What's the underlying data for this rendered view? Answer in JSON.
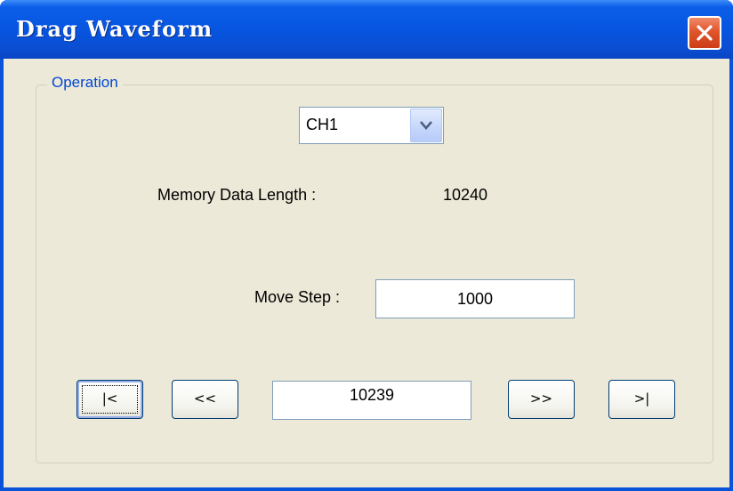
{
  "window": {
    "title": "Drag Waveform"
  },
  "group": {
    "legend": "Operation"
  },
  "channel": {
    "selected": "CH1"
  },
  "memory": {
    "label": "Memory Data Length :",
    "value": "10240"
  },
  "move_step": {
    "label": "Move Step :",
    "value": "1000"
  },
  "navigation": {
    "first_label": "|<",
    "prev_label": "<<",
    "position_value": "10239",
    "next_label": ">>",
    "last_label": ">|"
  },
  "icons": {
    "close": "close-icon",
    "dropdown": "chevron-down-icon"
  },
  "colors": {
    "titlebar": "#0755e0",
    "close_button": "#e0552c",
    "client_background": "#ece9d8",
    "group_legend": "#0046d5"
  }
}
